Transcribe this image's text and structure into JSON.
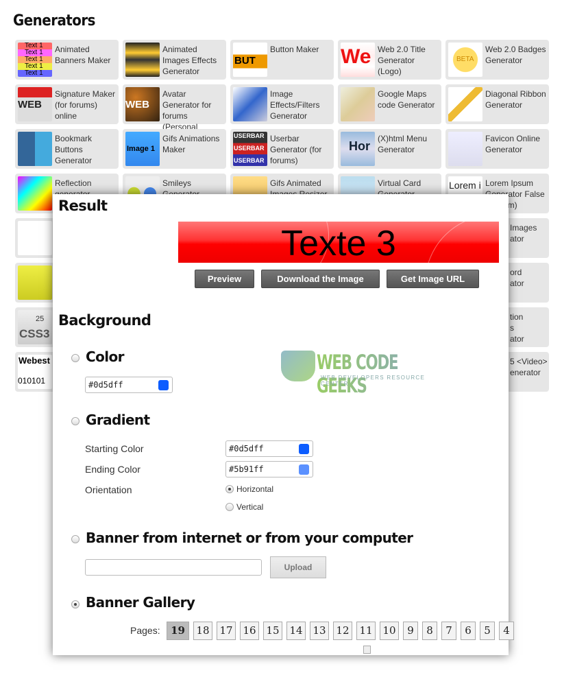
{
  "heading": "Generators",
  "tiles": [
    {
      "label": "Animated Banners Maker",
      "thumb": "text-banners"
    },
    {
      "label": "Animated Images Effects Generator",
      "thumb": "yellow-car"
    },
    {
      "label": "Button Maker",
      "thumb": "button"
    },
    {
      "label": "Web 2.0 Title Generator (Logo)",
      "thumb": "web-logo"
    },
    {
      "label": "Web 2.0 Badges Generator",
      "thumb": "beta-badge"
    },
    {
      "label": "Signature Maker (for forums) online",
      "thumb": "signature"
    },
    {
      "label": "Avatar Generator for forums (Personal Image)",
      "thumb": "avatar"
    },
    {
      "label": "Image Effects/Filters Generator",
      "thumb": "blue-car"
    },
    {
      "label": "Google Maps code Generator",
      "thumb": "map"
    },
    {
      "label": "Diagonal Ribbon Generator",
      "thumb": "ribbon"
    },
    {
      "label": "Bookmark Buttons Generator",
      "thumb": "social"
    },
    {
      "label": "Gifs Animations Maker",
      "thumb": "clock"
    },
    {
      "label": "Userbar Generator (for forums)",
      "thumb": "userbar"
    },
    {
      "label": "(X)html Menu Generator",
      "thumb": "menu"
    },
    {
      "label": "Favicon Online Generator",
      "thumb": "favicon"
    },
    {
      "label": "Reflection generator",
      "thumb": "rainbow"
    },
    {
      "label": "Smileys Generator",
      "thumb": "smileys"
    },
    {
      "label": "Gifs Animated Images Resizer",
      "thumb": "resizer"
    },
    {
      "label": "Virtual Card Generator",
      "thumb": "card"
    },
    {
      "label": "Lorem Ipsum Generator False (Lipsum)",
      "thumb": "lorem"
    }
  ],
  "hidden_fragments": [
    "Images\nator",
    "ord\nator",
    "tion\ns\nator",
    "5 <Video>\nenerator"
  ],
  "thumb_text": {
    "banner_line": "Text 1",
    "button": "BUT",
    "web": "We",
    "beta": "BETA",
    "sig": "WEB",
    "avatar": "WEB",
    "image1": "Image 1",
    "userbar": "USERBAR",
    "menu": "Hor",
    "lorem": "Lorem i",
    "css3": "CSS3",
    "css3_num": "25",
    "webest": "Webest",
    "binary": "010101"
  },
  "result": {
    "title": "Result",
    "banner_text": "Texte 3",
    "buttons": {
      "preview": "Preview",
      "download": "Download the Image",
      "url": "Get Image URL"
    },
    "background_title": "Background",
    "logo": {
      "name": "WEB CODE GEEKS",
      "tagline": "WEB DEVELOPERS RESOURCE CENTER"
    },
    "color": {
      "label": "Color",
      "value": "#0d5dff",
      "selected": false
    },
    "gradient": {
      "label": "Gradient",
      "selected": false,
      "start_label": "Starting Color",
      "start_value": "#0d5dff",
      "end_label": "Ending Color",
      "end_value": "#5b91ff",
      "orientation_label": "Orientation",
      "options": [
        "Horizontal",
        "Vertical"
      ],
      "orientation": "Horizontal"
    },
    "upload": {
      "label": "Banner from internet or from your computer",
      "value": "",
      "button": "Upload",
      "selected": false
    },
    "gallery": {
      "label": "Banner Gallery",
      "selected": true,
      "pages_label": "Pages:",
      "pages": [
        "19",
        "18",
        "17",
        "16",
        "15",
        "14",
        "13",
        "12",
        "11",
        "10",
        "9",
        "8",
        "7",
        "6",
        "5",
        "4"
      ],
      "current": "19"
    }
  },
  "colors": {
    "accent": "#0d5dff",
    "end": "#5b91ff",
    "banner": "#ff0000",
    "button": "#666666"
  }
}
